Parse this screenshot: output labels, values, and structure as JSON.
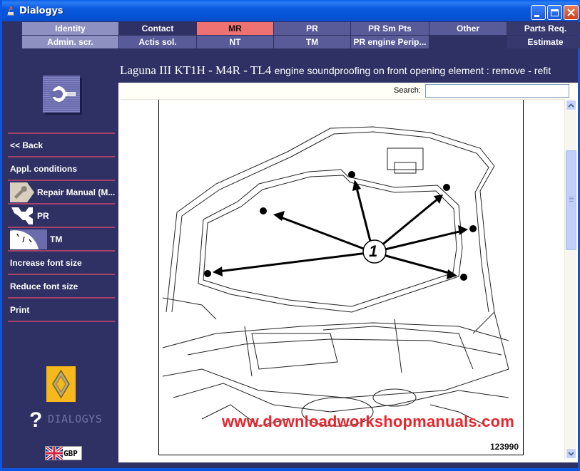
{
  "window": {
    "title": "Dialogys",
    "controls": [
      "minimize",
      "maximize",
      "close"
    ]
  },
  "topnav": {
    "row1": [
      {
        "label": "Identity",
        "state": "light"
      },
      {
        "label": "Contact",
        "state": "dark"
      },
      {
        "label": "MR",
        "state": "active"
      },
      {
        "label": "PR",
        "state": "mid"
      },
      {
        "label": "PR Sm Pts",
        "state": "mid"
      },
      {
        "label": "Other",
        "state": "mid"
      },
      {
        "label": "Parts Req.",
        "state": "navy"
      }
    ],
    "row2": [
      {
        "label": "Admin. scr.",
        "state": "light"
      },
      {
        "label": "Actis sol.",
        "state": "mid"
      },
      {
        "label": "NT",
        "state": "mid"
      },
      {
        "label": "TM",
        "state": "mid"
      },
      {
        "label": "PR engine Perip...",
        "state": "mid"
      },
      {
        "label": "",
        "state": "dark"
      },
      {
        "label": "Estimate",
        "state": "navy"
      }
    ]
  },
  "sidebar": {
    "header_icon": "wrench-icon",
    "items": [
      {
        "label": "<< Back",
        "icon": null
      },
      {
        "label": "Appl. conditions",
        "icon": null
      },
      {
        "label": "Repair Manual (M...",
        "icon": "repair-manual-icon"
      },
      {
        "label": "PR",
        "icon": "parts-icon"
      },
      {
        "label": "TM",
        "icon": "gauge-icon"
      },
      {
        "label": "Increase font size",
        "icon": null
      },
      {
        "label": "Reduce font size",
        "icon": null
      },
      {
        "label": "Print",
        "icon": null
      }
    ],
    "brand_logo": "renault-logo",
    "app_logo_text": "DIALOGYS",
    "language": "GBP"
  },
  "main": {
    "heading_model": "Laguna III KT1H - M4R - TL4",
    "heading_desc": "engine soundproofing on front opening element : remove - refit",
    "search_label": "Search:",
    "search_value": "",
    "figure": {
      "callout_label": "1",
      "figure_number": "123990",
      "watermark": "www.downloadworkshopmanuals.com"
    },
    "scroll_position": 0.18
  },
  "colors": {
    "window_bg": "#2f3063",
    "titlebar": "#0a58de",
    "active_tab": "#ef7272",
    "separator": "#a2426a",
    "watermark": "#e8242c"
  }
}
